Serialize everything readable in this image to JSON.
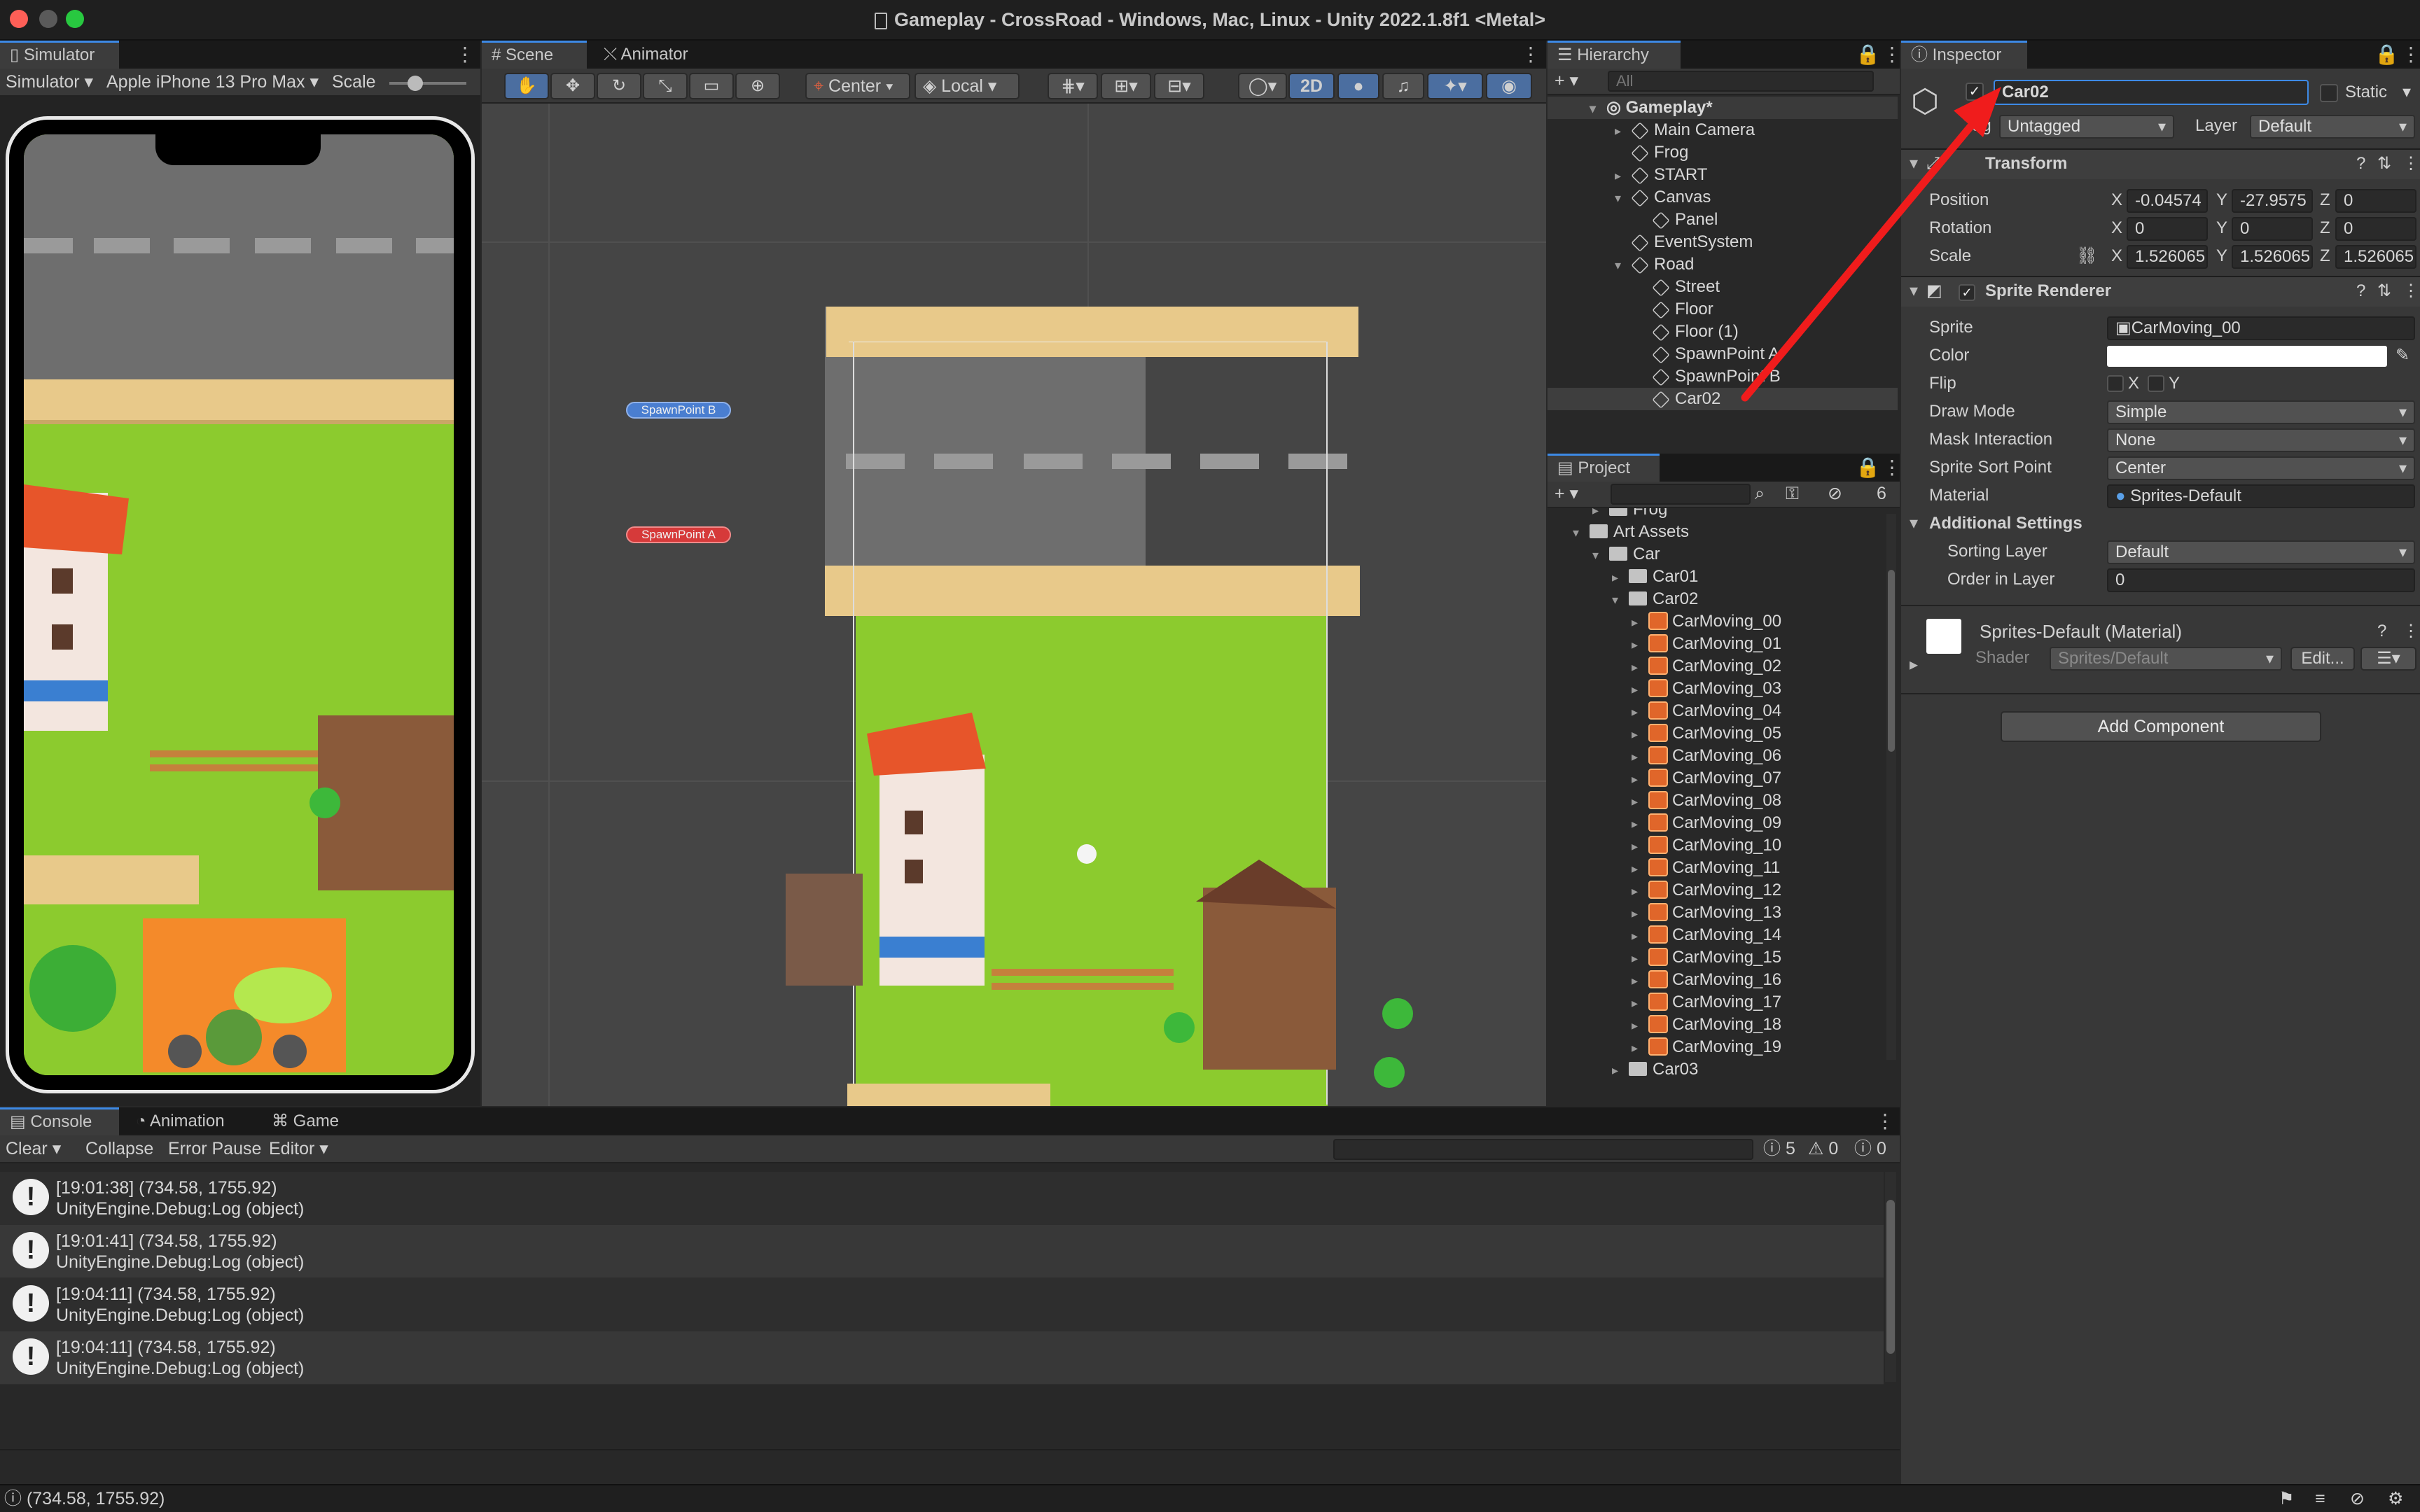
{
  "window": {
    "title": "Gameplay - CrossRoad - Windows, Mac, Linux - Unity 2022.1.8f1 <Metal>"
  },
  "simulator": {
    "tab": "Simulator",
    "mode": "Simulator",
    "device": "Apple iPhone 13 Pro Max",
    "scale_label": "Scale"
  },
  "scene": {
    "tabs": [
      "Scene",
      "Animator"
    ],
    "pivot": "Center",
    "space": "Local",
    "mode2d": "2D",
    "spawn_b": "SpawnPoint B",
    "spawn_a": "SpawnPoint A"
  },
  "hierarchy": {
    "tab": "Hierarchy",
    "search_placeholder": "All",
    "items": [
      {
        "label": "Gameplay*"
      },
      {
        "label": "Main Camera"
      },
      {
        "label": "Frog"
      },
      {
        "label": "START"
      },
      {
        "label": "Canvas"
      },
      {
        "label": "Panel"
      },
      {
        "label": "EventSystem"
      },
      {
        "label": "Road"
      },
      {
        "label": "Street"
      },
      {
        "label": "Floor"
      },
      {
        "label": "Floor (1)"
      },
      {
        "label": "SpawnPoint A"
      },
      {
        "label": "SpawnPoint B"
      },
      {
        "label": "Car02"
      }
    ]
  },
  "project": {
    "tab": "Project",
    "hidden_count": "6",
    "items": [
      {
        "label": "Frog"
      },
      {
        "label": "Art Assets"
      },
      {
        "label": "Car"
      },
      {
        "label": "Car01"
      },
      {
        "label": "Car02"
      },
      {
        "label": "CarMoving_00"
      },
      {
        "label": "CarMoving_01"
      },
      {
        "label": "CarMoving_02"
      },
      {
        "label": "CarMoving_03"
      },
      {
        "label": "CarMoving_04"
      },
      {
        "label": "CarMoving_05"
      },
      {
        "label": "CarMoving_06"
      },
      {
        "label": "CarMoving_07"
      },
      {
        "label": "CarMoving_08"
      },
      {
        "label": "CarMoving_09"
      },
      {
        "label": "CarMoving_10"
      },
      {
        "label": "CarMoving_11"
      },
      {
        "label": "CarMoving_12"
      },
      {
        "label": "CarMoving_13"
      },
      {
        "label": "CarMoving_14"
      },
      {
        "label": "CarMoving_15"
      },
      {
        "label": "CarMoving_16"
      },
      {
        "label": "CarMoving_17"
      },
      {
        "label": "CarMoving_18"
      },
      {
        "label": "CarMoving_19"
      },
      {
        "label": "Car03"
      }
    ]
  },
  "inspector": {
    "tab": "Inspector",
    "name": "Car02",
    "static_label": "Static",
    "tag_label": "Tag",
    "tag_value": "Untagged",
    "layer_label": "Layer",
    "layer_value": "Default",
    "transform": {
      "title": "Transform",
      "position_label": "Position",
      "rotation_label": "Rotation",
      "scale_label": "Scale",
      "pos": {
        "x": "-0.04574",
        "y": "-27.9575",
        "z": "0"
      },
      "rot": {
        "x": "0",
        "y": "0",
        "z": "0"
      },
      "scale": {
        "x": "1.526065",
        "y": "1.526065",
        "z": "1.526065"
      }
    },
    "sprite_renderer": {
      "title": "Sprite Renderer",
      "sprite_label": "Sprite",
      "sprite_value": "CarMoving_00",
      "color_label": "Color",
      "flip_label": "Flip",
      "flip_x": "X",
      "flip_y": "Y",
      "draw_mode_label": "Draw Mode",
      "draw_mode": "Simple",
      "mask_label": "Mask Interaction",
      "mask": "None",
      "sort_point_label": "Sprite Sort Point",
      "sort_point": "Center",
      "material_label": "Material",
      "material": "Sprites-Default",
      "additional": "Additional Settings",
      "sorting_layer_label": "Sorting Layer",
      "sorting_layer": "Default",
      "order_label": "Order in Layer",
      "order": "0"
    },
    "material_block": {
      "title": "Sprites-Default (Material)",
      "shader_label": "Shader",
      "shader": "Sprites/Default",
      "edit": "Edit..."
    },
    "add_component": "Add Component"
  },
  "console": {
    "tabs": [
      "Console",
      "Animation",
      "Game"
    ],
    "clear": "Clear",
    "collapse": "Collapse",
    "error_pause": "Error Pause",
    "editor": "Editor",
    "counts": {
      "log": "5",
      "warn": "0",
      "error": "0"
    },
    "messages": [
      {
        "line1": "[19:01:38] (734.58, 1755.92)",
        "line2": "UnityEngine.Debug:Log (object)"
      },
      {
        "line1": "[19:01:41] (734.58, 1755.92)",
        "line2": "UnityEngine.Debug:Log (object)"
      },
      {
        "line1": "[19:04:11] (734.58, 1755.92)",
        "line2": "UnityEngine.Debug:Log (object)"
      },
      {
        "line1": "[19:04:11] (734.58, 1755.92)",
        "line2": "UnityEngine.Debug:Log (object)"
      }
    ]
  },
  "statusbar": {
    "text": "(734.58, 1755.92)"
  },
  "colors": {
    "accent": "#3d8ae6",
    "arrow": "#f01c1c",
    "grass": "#8ccb2e",
    "road": "#6e6e6e",
    "sidewalk": "#e8c98a",
    "roof": "#e7552a"
  }
}
